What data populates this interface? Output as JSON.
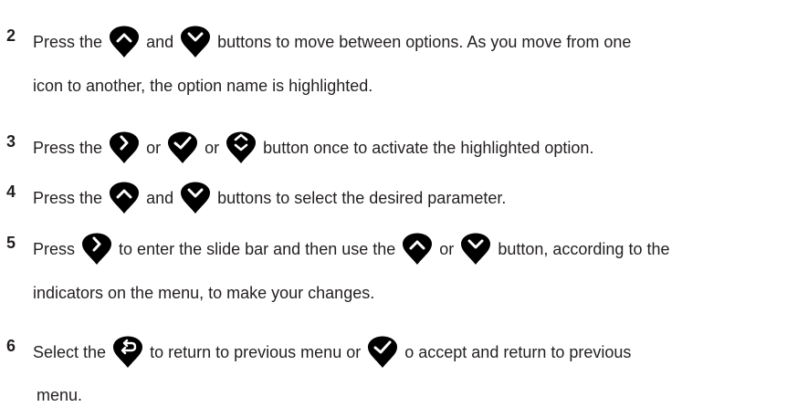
{
  "steps": [
    {
      "number": "2",
      "parts": [
        "Press the",
        "and",
        "buttons to move between options. As you move from one"
      ],
      "icons": [
        "up-icon",
        "down-icon"
      ],
      "continuation": "icon to another, the option name is highlighted."
    },
    {
      "number": "3",
      "parts": [
        "Press the",
        "or",
        "or",
        "button once to activate the highlighted option."
      ],
      "icons": [
        "right-icon",
        "check-icon",
        "up-down-icon"
      ]
    },
    {
      "number": "4",
      "parts": [
        "Press the",
        "and",
        "buttons to select the desired parameter."
      ],
      "icons": [
        "up-icon",
        "down-icon"
      ]
    },
    {
      "number": "5",
      "parts": [
        "Press",
        "to enter the slide bar and then use the",
        "or",
        "button, according to the"
      ],
      "icons": [
        "right-icon",
        "up-icon",
        "down-icon"
      ],
      "continuation": "indicators on the menu, to make your changes."
    },
    {
      "number": "6",
      "parts": [
        "Select the",
        "to return to previous menu or",
        "o accept and return to previous"
      ],
      "icons": [
        "back-icon",
        "check-icon"
      ],
      "continuation": "menu."
    }
  ],
  "colors": {
    "text": "#231f20",
    "icon": "#000000"
  }
}
